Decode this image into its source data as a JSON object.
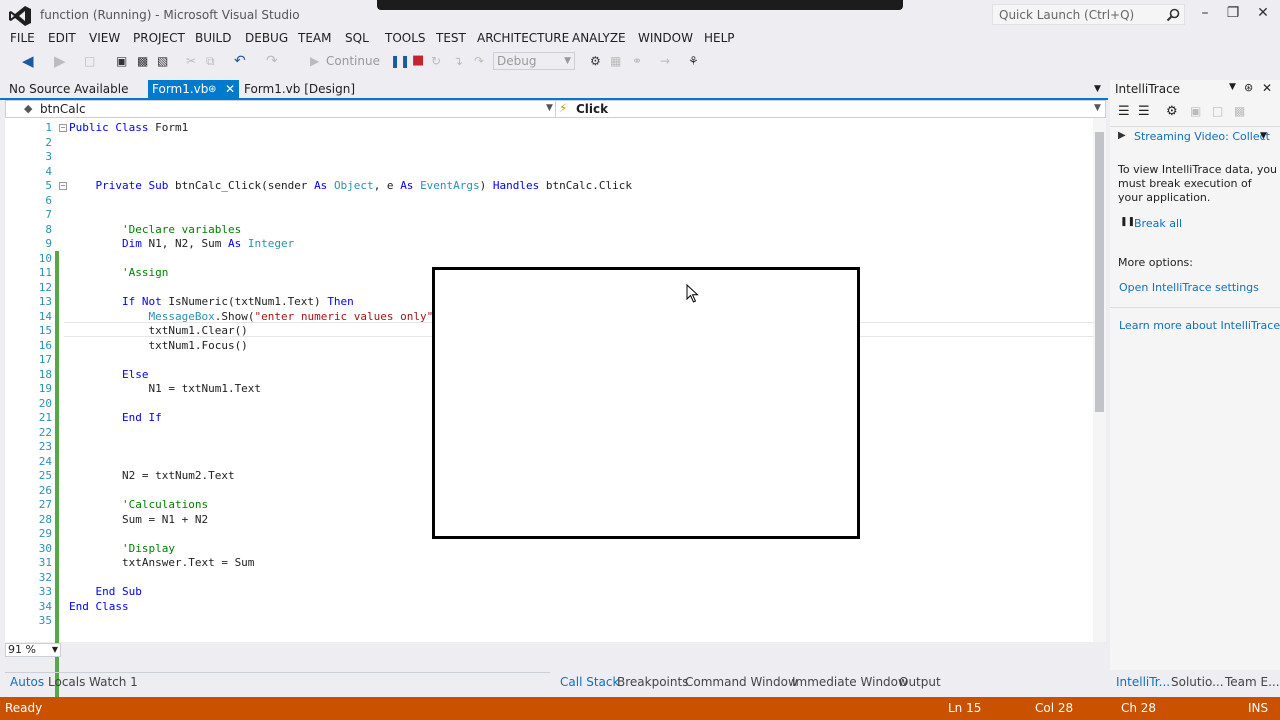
{
  "window": {
    "title": "function (Running) - Microsoft Visual Studio",
    "quick_launch_placeholder": "Quick Launch (Ctrl+Q)"
  },
  "menu": [
    "FILE",
    "EDIT",
    "VIEW",
    "PROJECT",
    "BUILD",
    "DEBUG",
    "TEAM",
    "SQL",
    "TOOLS",
    "TEST",
    "ARCHITECTURE",
    "ANALYZE",
    "WINDOW",
    "HELP"
  ],
  "toolbar": {
    "continue_label": "Continue",
    "config_value": "Debug"
  },
  "doc_tabs": {
    "no_source": "No Source Available",
    "form1vb": "Form1.vb",
    "form1design": "Form1.vb [Design]"
  },
  "navbar": {
    "left": "btnCalc",
    "right": "Click"
  },
  "code_lines": [
    {
      "n": "1",
      "t": "Public Class Form1"
    },
    {
      "n": "2",
      "t": ""
    },
    {
      "n": "3",
      "t": ""
    },
    {
      "n": "4",
      "t": ""
    },
    {
      "n": "5",
      "t": "    Private Sub btnCalc_Click(sender As Object, e As EventArgs) Handles btnCalc.Click"
    },
    {
      "n": "6",
      "t": ""
    },
    {
      "n": "7",
      "t": ""
    },
    {
      "n": "8",
      "t": "        'Declare variables"
    },
    {
      "n": "9",
      "t": "        Dim N1, N2, Sum As Integer"
    },
    {
      "n": "10",
      "t": ""
    },
    {
      "n": "11",
      "t": "        'Assign"
    },
    {
      "n": "12",
      "t": ""
    },
    {
      "n": "13",
      "t": "        If Not IsNumeric(txtNum1.Text) Then"
    },
    {
      "n": "14",
      "t": "            MessageBox.Show(\"enter numeric values only\")"
    },
    {
      "n": "15",
      "t": "            txtNum1.Clear()"
    },
    {
      "n": "16",
      "t": "            txtNum1.Focus()"
    },
    {
      "n": "17",
      "t": ""
    },
    {
      "n": "18",
      "t": "        Else"
    },
    {
      "n": "19",
      "t": "            N1 = txtNum1.Text"
    },
    {
      "n": "20",
      "t": ""
    },
    {
      "n": "21",
      "t": "        End If"
    },
    {
      "n": "22",
      "t": ""
    },
    {
      "n": "23",
      "t": ""
    },
    {
      "n": "24",
      "t": ""
    },
    {
      "n": "25",
      "t": "        N2 = txtNum2.Text"
    },
    {
      "n": "26",
      "t": ""
    },
    {
      "n": "27",
      "t": "        'Calculations"
    },
    {
      "n": "28",
      "t": "        Sum = N1 + N2"
    },
    {
      "n": "29",
      "t": ""
    },
    {
      "n": "30",
      "t": "        'Display"
    },
    {
      "n": "31",
      "t": "        txtAnswer.Text = Sum"
    },
    {
      "n": "32",
      "t": ""
    },
    {
      "n": "33",
      "t": "    End Sub"
    },
    {
      "n": "34",
      "t": "End Class"
    },
    {
      "n": "35",
      "t": ""
    }
  ],
  "zoom": "91 %",
  "bottom_left_tabs": [
    "Autos",
    "Locals",
    "Watch 1"
  ],
  "bottom_mid_tabs": [
    "Call Stack",
    "Breakpoints",
    "Command Window",
    "Immediate Window",
    "Output"
  ],
  "bottom_right_tabs": [
    "IntelliTr...",
    "Solutio...",
    "Team E..."
  ],
  "status": {
    "ready": "Ready",
    "ln": "Ln 15",
    "col": "Col 28",
    "ch": "Ch 28",
    "ins": "INS"
  },
  "intellitrace": {
    "title": "IntelliTrace",
    "streaming": "Streaming Video: Collect",
    "info": "To view IntelliTrace data, you must break execution of your application.",
    "break_all": "Break all",
    "more_options": "More options:",
    "open_settings": "Open IntelliTrace settings",
    "learn_more": "Learn more about IntelliTrace"
  },
  "colors": {
    "accent": "#007acc",
    "status_bar": "#ca5100",
    "link": "#0e70c0"
  }
}
